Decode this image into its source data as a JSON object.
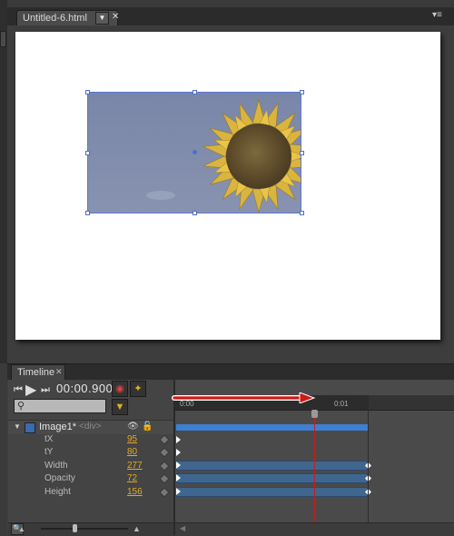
{
  "document": {
    "tab_title": "Untitled-6.html",
    "tab_dropdown": "▼",
    "tab_close": "✕",
    "panel_menu": "▾≡"
  },
  "timeline": {
    "tab_label": "Timeline",
    "tab_close": "✕",
    "time": "00:00.900",
    "ruler_ticks": [
      "0:00",
      "0:01"
    ],
    "element": {
      "name": "Image1*",
      "tag": "<div>"
    },
    "properties": [
      {
        "label": "tX",
        "value": "95"
      },
      {
        "label": "tY",
        "value": "80"
      },
      {
        "label": "Width",
        "value": "277"
      },
      {
        "label": "Opacity",
        "value": "72"
      },
      {
        "label": "Height",
        "value": "156"
      }
    ]
  },
  "icons": {
    "go_start": "⏮",
    "play": "▶",
    "go_end": "⏭",
    "autokey": "◉",
    "pin": "✦",
    "search": "⚲",
    "filter": "▼",
    "eye": "👁",
    "lock": "🔓",
    "expand_arrow": "▼",
    "zoom_out": "▲",
    "zoom_in": "▲"
  },
  "colors": {
    "accent_blue": "#3e7fd0",
    "playhead_red": "#c02020",
    "value_orange": "#e1a82a",
    "arrow_red": "#d01818"
  }
}
